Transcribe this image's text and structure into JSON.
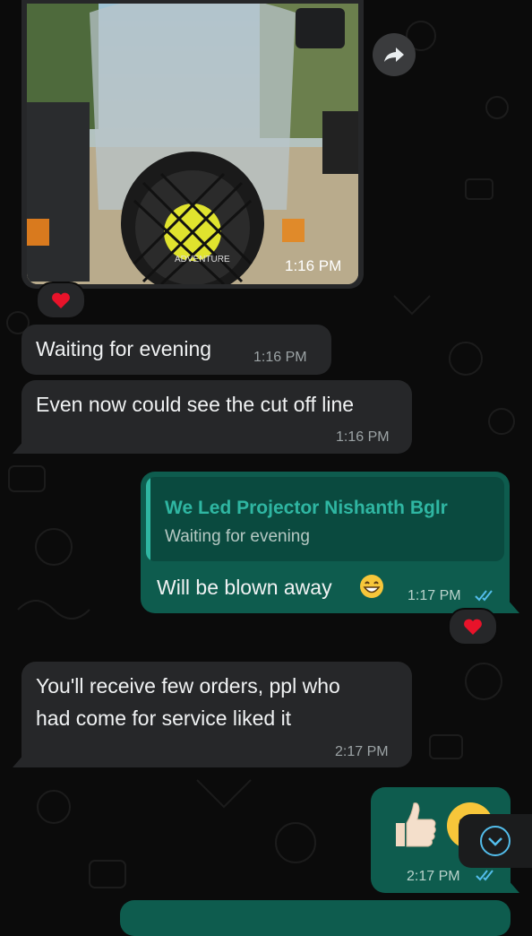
{
  "messages": [
    {
      "id": "photo",
      "direction": "incoming",
      "type": "image",
      "time": "1:16 PM",
      "image_text": "ADVENTURE",
      "reaction": "heart"
    },
    {
      "id": "m1",
      "direction": "incoming",
      "text": "Waiting for evening",
      "time": "1:16 PM"
    },
    {
      "id": "m2",
      "direction": "incoming",
      "text": "Even now could see the cut off line",
      "time": "1:16 PM"
    },
    {
      "id": "m3",
      "direction": "outgoing",
      "reply_to": {
        "author": "We Led Projector Nishanth Bglr",
        "text": "Waiting for evening"
      },
      "text": "Will be blown away",
      "emoji": "grinning-face-with-smiling-eyes",
      "time": "1:17 PM",
      "status": "read",
      "reaction": "heart"
    },
    {
      "id": "m4",
      "direction": "incoming",
      "lines": [
        "You'll receive few orders, ppl who",
        "had come for service liked it"
      ],
      "time": "2:17 PM"
    },
    {
      "id": "m5",
      "direction": "outgoing",
      "type": "emoji",
      "emojis": [
        "thumbs-up",
        "grinning-face"
      ],
      "time": "2:17 PM",
      "status": "read"
    },
    {
      "id": "m6",
      "direction": "outgoing",
      "partial": true
    }
  ],
  "colors": {
    "incoming_bubble": "#262729",
    "outgoing_bubble": "#0e5c4e",
    "quote_accent": "#2fb6a2",
    "read_ticks": "#53bdeb"
  }
}
